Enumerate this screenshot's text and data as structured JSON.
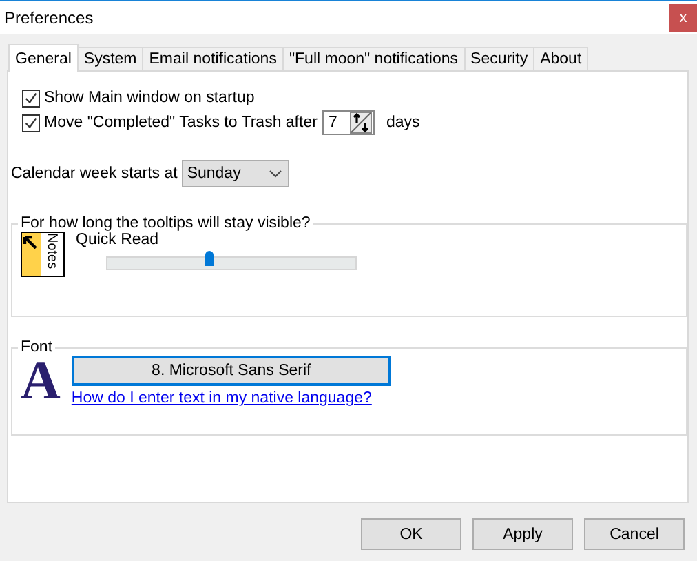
{
  "window": {
    "title": "Preferences",
    "close": "x"
  },
  "tabs": [
    {
      "label": "General",
      "selected": true
    },
    {
      "label": "System",
      "selected": false
    },
    {
      "label": "Email notifications",
      "selected": false
    },
    {
      "label": "\"Full moon\" notifications",
      "selected": false
    },
    {
      "label": "Security",
      "selected": false
    },
    {
      "label": "About",
      "selected": false
    }
  ],
  "options": [
    {
      "label": "Show Main window on startup",
      "checked": true
    },
    {
      "label": "Move \"Completed\" Tasks to Trash after",
      "checked": true,
      "value": "7",
      "suffix": "days"
    }
  ],
  "week_start": {
    "label": "Calendar week starts at",
    "value": "Sunday"
  },
  "tooltips": {
    "title": "For how long the tooltips will stay visible?",
    "icon_text": "Notes",
    "label": "Quick Read",
    "level": 0.41
  },
  "font": {
    "title": "Font",
    "letter": "A",
    "button": "8. Microsoft Sans Serif",
    "link": "How do I enter text in my native language?"
  },
  "buttons": [
    "OK",
    "Apply",
    "Cancel"
  ]
}
